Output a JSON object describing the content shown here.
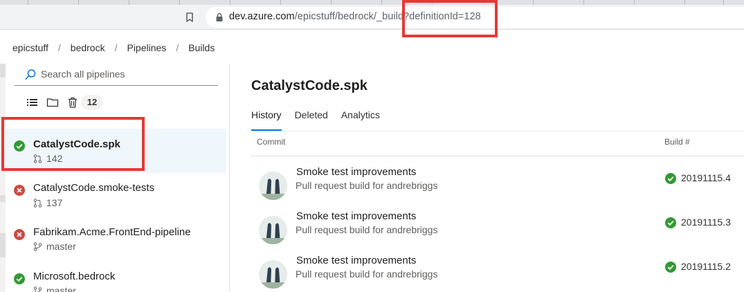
{
  "browser": {
    "url_host": "dev.azure.com",
    "url_path": "/epicstuff/bedrock/_build?definitionId=128"
  },
  "breadcrumb": [
    "epicstuff",
    "bedrock",
    "Pipelines",
    "Builds"
  ],
  "sidebar": {
    "search_placeholder": "Search all pipelines",
    "count_badge": "12",
    "pipelines": [
      {
        "name": "CatalystCode.spk",
        "sub": "142",
        "sub_icon": "pull-request-icon",
        "status": "succeeded"
      },
      {
        "name": "CatalystCode.smoke-tests",
        "sub": "137",
        "sub_icon": "pull-request-icon",
        "status": "failed"
      },
      {
        "name": "Fabrikam.Acme.FrontEnd-pipeline",
        "sub": "master",
        "sub_icon": "branch-icon",
        "status": "failed"
      },
      {
        "name": "Microsoft.bedrock",
        "sub": "master",
        "sub_icon": "branch-icon",
        "status": "succeeded"
      }
    ]
  },
  "main": {
    "title": "CatalystCode.spk",
    "tabs": [
      {
        "label": "History",
        "active": true
      },
      {
        "label": "Deleted",
        "active": false
      },
      {
        "label": "Analytics",
        "active": false
      }
    ],
    "columns": {
      "commit": "Commit",
      "build": "Build #"
    },
    "runs": [
      {
        "title": "Smoke test improvements",
        "subtitle": "Pull request build for andrebriggs",
        "build": "20191115.4",
        "status": "succeeded"
      },
      {
        "title": "Smoke test improvements",
        "subtitle": "Pull request build for andrebriggs",
        "build": "20191115.3",
        "status": "succeeded"
      },
      {
        "title": "Smoke test improvements",
        "subtitle": "Pull request build for andrebriggs",
        "build": "20191115.2",
        "status": "succeeded"
      }
    ]
  },
  "colors": {
    "success": "#339933",
    "failure": "#cd4a45",
    "accent": "#0078d4",
    "highlight": "#e53935"
  }
}
